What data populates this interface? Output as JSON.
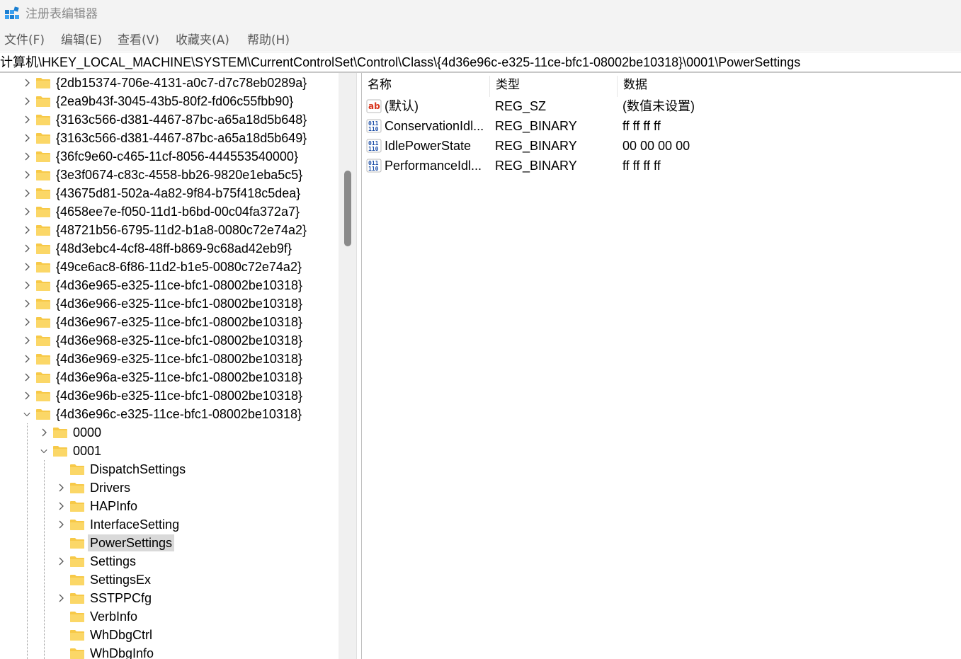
{
  "window": {
    "title": "注册表编辑器"
  },
  "menu": [
    "文件(F)",
    "编辑(E)",
    "查看(V)",
    "收藏夹(A)",
    "帮助(H)"
  ],
  "address": {
    "path": "计算机\\HKEY_LOCAL_MACHINE\\SYSTEM\\CurrentControlSet\\Control\\Class\\{4d36e96c-e325-11ce-bfc1-08002be10318}\\0001\\PowerSettings"
  },
  "tree": {
    "items": [
      {
        "label": "{2db15374-706e-4131-a0c7-d7c78eb0289a}",
        "level": 0,
        "expander": "collapsed"
      },
      {
        "label": "{2ea9b43f-3045-43b5-80f2-fd06c55fbb90}",
        "level": 0,
        "expander": "collapsed"
      },
      {
        "label": "{3163c566-d381-4467-87bc-a65a18d5b648}",
        "level": 0,
        "expander": "collapsed"
      },
      {
        "label": "{3163c566-d381-4467-87bc-a65a18d5b649}",
        "level": 0,
        "expander": "collapsed"
      },
      {
        "label": "{36fc9e60-c465-11cf-8056-444553540000}",
        "level": 0,
        "expander": "collapsed"
      },
      {
        "label": "{3e3f0674-c83c-4558-bb26-9820e1eba5c5}",
        "level": 0,
        "expander": "collapsed"
      },
      {
        "label": "{43675d81-502a-4a82-9f84-b75f418c5dea}",
        "level": 0,
        "expander": "collapsed"
      },
      {
        "label": "{4658ee7e-f050-11d1-b6bd-00c04fa372a7}",
        "level": 0,
        "expander": "collapsed"
      },
      {
        "label": "{48721b56-6795-11d2-b1a8-0080c72e74a2}",
        "level": 0,
        "expander": "collapsed"
      },
      {
        "label": "{48d3ebc4-4cf8-48ff-b869-9c68ad42eb9f}",
        "level": 0,
        "expander": "collapsed"
      },
      {
        "label": "{49ce6ac8-6f86-11d2-b1e5-0080c72e74a2}",
        "level": 0,
        "expander": "collapsed"
      },
      {
        "label": "{4d36e965-e325-11ce-bfc1-08002be10318}",
        "level": 0,
        "expander": "collapsed"
      },
      {
        "label": "{4d36e966-e325-11ce-bfc1-08002be10318}",
        "level": 0,
        "expander": "collapsed"
      },
      {
        "label": "{4d36e967-e325-11ce-bfc1-08002be10318}",
        "level": 0,
        "expander": "collapsed"
      },
      {
        "label": "{4d36e968-e325-11ce-bfc1-08002be10318}",
        "level": 0,
        "expander": "collapsed"
      },
      {
        "label": "{4d36e969-e325-11ce-bfc1-08002be10318}",
        "level": 0,
        "expander": "collapsed"
      },
      {
        "label": "{4d36e96a-e325-11ce-bfc1-08002be10318}",
        "level": 0,
        "expander": "collapsed"
      },
      {
        "label": "{4d36e96b-e325-11ce-bfc1-08002be10318}",
        "level": 0,
        "expander": "collapsed"
      },
      {
        "label": "{4d36e96c-e325-11ce-bfc1-08002be10318}",
        "level": 0,
        "expander": "expanded"
      },
      {
        "label": "0000",
        "level": 1,
        "expander": "collapsed"
      },
      {
        "label": "0001",
        "level": 1,
        "expander": "expanded"
      },
      {
        "label": "DispatchSettings",
        "level": 2,
        "expander": "none"
      },
      {
        "label": "Drivers",
        "level": 2,
        "expander": "collapsed"
      },
      {
        "label": "HAPInfo",
        "level": 2,
        "expander": "collapsed"
      },
      {
        "label": "InterfaceSetting",
        "level": 2,
        "expander": "collapsed"
      },
      {
        "label": "PowerSettings",
        "level": 2,
        "expander": "none",
        "selected": true
      },
      {
        "label": "Settings",
        "level": 2,
        "expander": "collapsed"
      },
      {
        "label": "SettingsEx",
        "level": 2,
        "expander": "none"
      },
      {
        "label": "SSTPPCfg",
        "level": 2,
        "expander": "collapsed"
      },
      {
        "label": "VerbInfo",
        "level": 2,
        "expander": "none"
      },
      {
        "label": "WhDbgCtrl",
        "level": 2,
        "expander": "none"
      },
      {
        "label": "WhDbgInfo",
        "level": 2,
        "expander": "none"
      }
    ]
  },
  "list": {
    "columns": [
      "名称",
      "类型",
      "数据"
    ],
    "rows": [
      {
        "name": "(默认)",
        "type": "REG_SZ",
        "data": "(数值未设置)",
        "icon": "string-value-icon"
      },
      {
        "name": "ConservationIdl...",
        "type": "REG_BINARY",
        "data": "ff ff ff ff",
        "icon": "binary-value-icon"
      },
      {
        "name": "IdlePowerState",
        "type": "REG_BINARY",
        "data": "00 00 00 00",
        "icon": "binary-value-icon"
      },
      {
        "name": "PerformanceIdl...",
        "type": "REG_BINARY",
        "data": "ff ff ff ff",
        "icon": "binary-value-icon"
      }
    ]
  },
  "colors": {
    "folder": "#f7c948",
    "selection": "#d9d9d9",
    "chrome": "#f3f3f3"
  }
}
